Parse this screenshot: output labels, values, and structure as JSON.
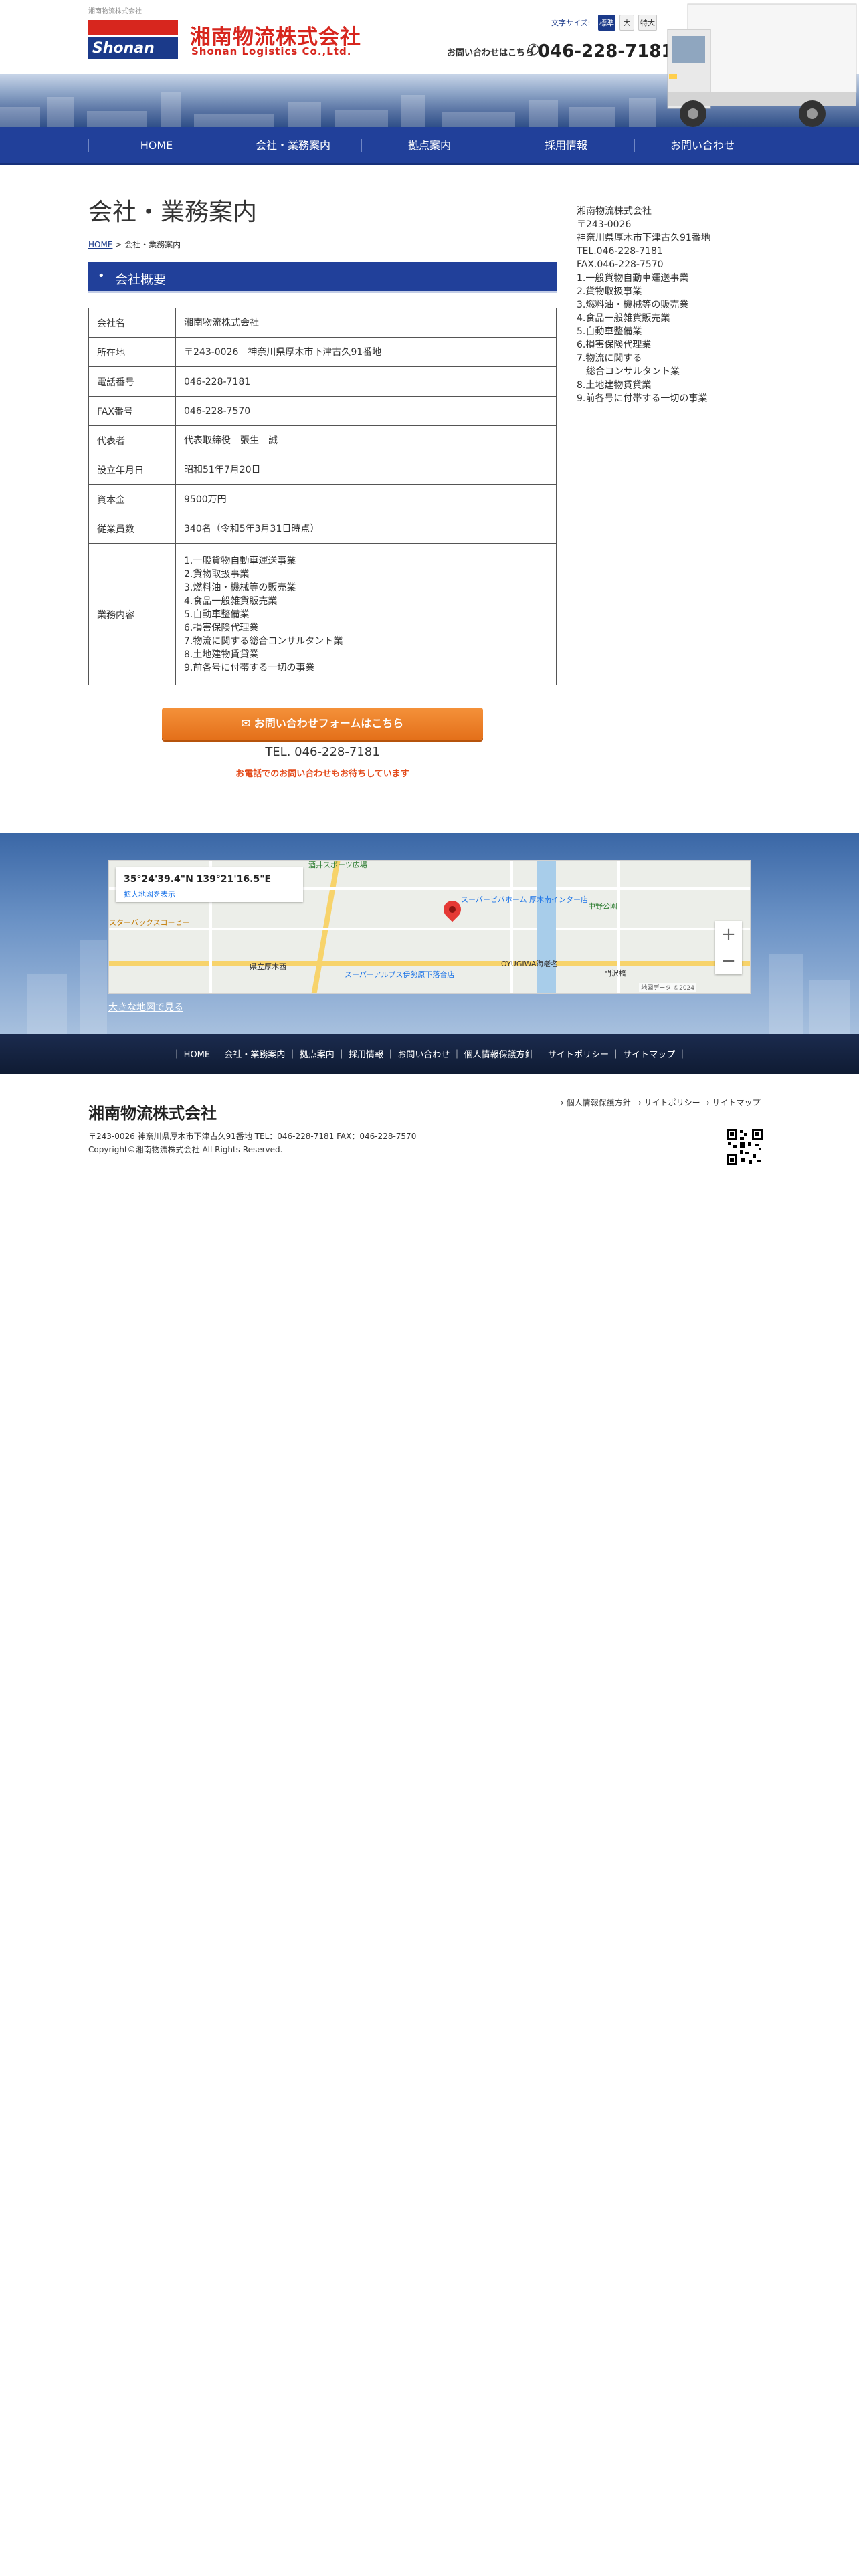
{
  "header": {
    "tagline": "湘南物流株式会社",
    "logo_text": "Shonan",
    "company_jp": "湘南物流株式会社",
    "company_en": "Shonan Logistics Co.,Ltd.",
    "font_size_label": "文字サイズ:",
    "font_sizes": [
      "標準",
      "大",
      "特大"
    ],
    "contact_label": "お問い合わせはこちら",
    "phone_icon": "",
    "phone": "046-228-7181"
  },
  "nav": {
    "items": [
      {
        "label": "HOME"
      },
      {
        "label": "会社・業務案内"
      },
      {
        "label": "拠点案内"
      },
      {
        "label": "採用情報"
      },
      {
        "label": "お問い合わせ"
      }
    ]
  },
  "main": {
    "title": "会社・業務案内",
    "breadcrumb": {
      "home": "HOME",
      "separator": ">",
      "current": "会社・業務案内"
    },
    "section_bullet": "•",
    "section_title": "会社概要",
    "table": [
      {
        "label": "会社名",
        "value": "湘南物流株式会社"
      },
      {
        "label": "所在地",
        "value": "〒243-0026　神奈川県厚木市下津古久91番地"
      },
      {
        "label": "電話番号",
        "value": "046-228-7181"
      },
      {
        "label": "FAX番号",
        "value": "046-228-7570"
      },
      {
        "label": "代表者",
        "value": "代表取締役　張生　誠"
      },
      {
        "label": "設立年月日",
        "value": "昭和51年7月20日"
      },
      {
        "label": "資本金",
        "value": "9500万円"
      },
      {
        "label": "従業員数",
        "value": "340名（令和5年3月31日時点）"
      },
      {
        "label": "業務内容",
        "lines": [
          "1.一般貨物自動車運送事業",
          "2.貨物取扱事業",
          "3.燃料油・機械等の販売業",
          "4.食品一般雑貨販売業",
          "5.自動車整備業",
          "6.損害保険代理業",
          "7.物流に関する総合コンサルタント業",
          "8.土地建物賃貸業",
          "9.前各号に付帯する一切の事業"
        ]
      }
    ],
    "cta_label": " お問い合わせフォームはこちら",
    "cta_tel": "TEL. 046-228-7181",
    "cta_note": "お電話でのお問い合わせもお待ちしています"
  },
  "sidebar": {
    "lines": [
      "湘南物流株式会社",
      "〒243-0026",
      "神奈川県厚木市下津古久91番地",
      "TEL.046-228-7181",
      "FAX.046-228-7570",
      "1.一般貨物自動車運送事業",
      "2.貨物取扱事業",
      "3.燃料油・機械等の販売業",
      "4.食品一般雑貨販売業",
      "5.自動車整備業",
      "6.損害保険代理業",
      "7.物流に関する",
      "　総合コンサルタント業",
      "8.土地建物賃貸業",
      "9.前各号に付帯する一切の事業"
    ]
  },
  "map": {
    "coords": "35°24'39.4\"N 139°21'16.5\"E",
    "detail_link": "拡大地図を表示",
    "labels": [
      "酒井スポーツ広場",
      "スーパーピバホーム 厚木南インター店",
      "中野公園",
      "スターバックスコーヒー",
      "OYUGIWA海老名",
      "門沢橋",
      "スーパーアルプス伊勢原下落合店",
      "県立厚木西"
    ],
    "zoom_in": "+",
    "zoom_out": "−",
    "copyright": "地図データ ©2024",
    "big_map_link": "大きな地図で見る"
  },
  "footer_nav": {
    "items": [
      "HOME",
      "会社・業務案内",
      "拠点案内",
      "採用情報",
      "お問い合わせ",
      "個人情報保護方針",
      "サイトポリシー",
      "サイトマップ"
    ]
  },
  "footer": {
    "company": "湘南物流株式会社",
    "address": "〒243-0026 神奈川県厚木市下津古久91番地 TEL：046-228-7181 FAX：046-228-7570",
    "copyright": "Copyright©湘南物流株式会社 All Rights Reserved.",
    "links": [
      "個人情報保護方針",
      "サイトポリシー",
      "サイトマップ"
    ]
  },
  "colors": {
    "brand_blue": "#21409a",
    "brand_red": "#d7261e",
    "cta_orange": "#e4701a",
    "note_red": "#e44b1b"
  }
}
